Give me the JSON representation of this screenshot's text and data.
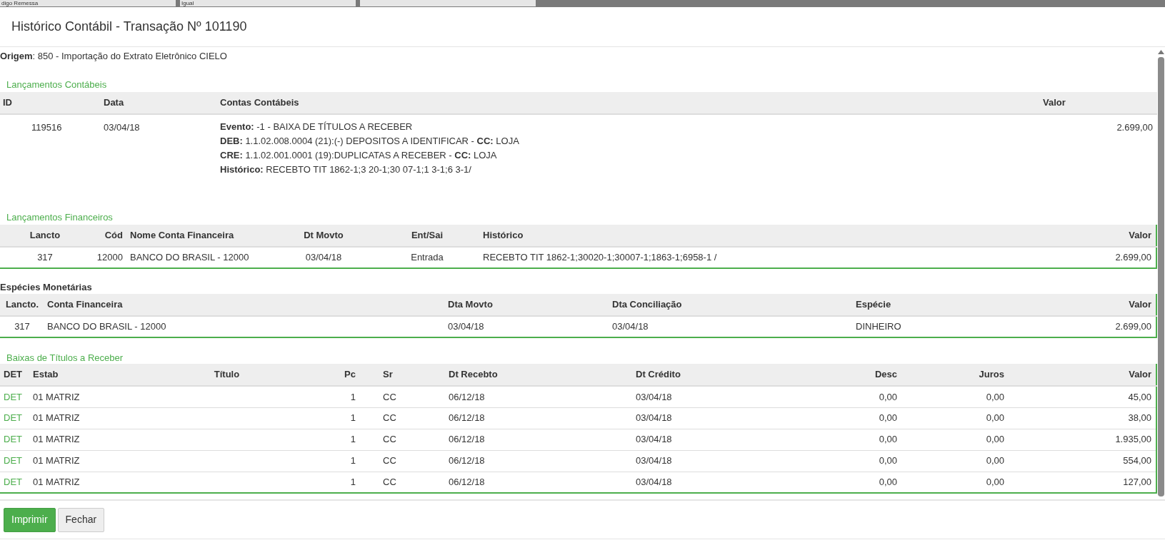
{
  "background_page": {
    "fields": [
      "digo Remessa",
      "Igual"
    ]
  },
  "dialog": {
    "title": "Histórico Contábil - Transação Nº 101190"
  },
  "origin": "**Origem**: 850 - Importação do Extrato Eletrônico CIELO",
  "accounting_entries": {
    "title": "Lançamentos Contábeis",
    "columns": [
      "ID",
      "Data",
      "Contas Contábeis",
      "Valor"
    ],
    "rows": [
      {
        "id": "119516",
        "date": "03/04/18",
        "lines": [
          "**Evento:** -1 - BAIXA DE TÍTULOS A RECEBER",
          "**DEB:** 1.1.02.008.0004 (21):(-) DEPOSITOS A IDENTIFICAR - **CC:** LOJA",
          "**CRE:** 1.1.02.001.0001 (19):DUPLICATAS A RECEBER - **CC:** LOJA",
          "**Histórico:** RECEBTO TIT 1862-1;3  20-1;30  07-1;1  3-1;6  3-1/"
        ],
        "value": "2.699,00"
      }
    ]
  },
  "financial_entries": {
    "title": "Lançamentos Financeiros",
    "columns": [
      "Lancto",
      "Cód",
      "Nome Conta Financeira",
      "Dt Movto",
      "Ent/Sai",
      "Histórico",
      "Valor"
    ],
    "rows": [
      [
        "317",
        "12000",
        "BANCO DO BRASIL - 12000",
        "03/04/18",
        "Entrada",
        "RECEBTO TIT 1862-1;30020-1;30007-1;1863-1;6958-1 /",
        "2.699,00"
      ]
    ]
  },
  "cash_species": {
    "title": "Espécies Monetárias",
    "columns": [
      "Lancto.",
      "Conta Financeira",
      "Dta Movto",
      "Dta Conciliação",
      "Espécie",
      "Valor"
    ],
    "rows": [
      [
        "317",
        "BANCO DO BRASIL - 12000",
        "03/04/18",
        "03/04/18",
        "DINHEIRO",
        "2.699,00"
      ]
    ]
  },
  "receivables": {
    "title": "Baixas de Títulos a Receber",
    "columns": [
      "DET",
      "Estab",
      "Título",
      "Pc",
      "Sr",
      "Dt Recebto",
      "Dt Crédito",
      "Desc",
      "Juros",
      "Valor"
    ],
    "rows": [
      {
        "det": "DET",
        "estab": "01 MATRIZ",
        "pc": "1",
        "sr": "CC",
        "received": "06/12/18",
        "credited": "03/04/18",
        "discount": "0,00",
        "interest": "0,00",
        "value": "45,00"
      },
      {
        "det": "DET",
        "estab": "01 MATRIZ",
        "pc": "1",
        "sr": "CC",
        "received": "06/12/18",
        "credited": "03/04/18",
        "discount": "0,00",
        "interest": "0,00",
        "value": "38,00"
      },
      {
        "det": "DET",
        "estab": "01 MATRIZ",
        "pc": "1",
        "sr": "CC",
        "received": "06/12/18",
        "credited": "03/04/18",
        "discount": "0,00",
        "interest": "0,00",
        "value": "1.935,00"
      },
      {
        "det": "DET",
        "estab": "01 MATRIZ",
        "pc": "1",
        "sr": "CC",
        "received": "06/12/18",
        "credited": "03/04/18",
        "discount": "0,00",
        "interest": "0,00",
        "value": "554,00"
      },
      {
        "det": "DET",
        "estab": "01 MATRIZ",
        "pc": "1",
        "sr": "CC",
        "received": "06/12/18",
        "credited": "03/04/18",
        "discount": "0,00",
        "interest": "0,00",
        "value": "127,00"
      }
    ]
  },
  "buttons": [
    {
      "label": "Imprimir",
      "kind": "primary"
    },
    {
      "label": "Fechar",
      "kind": "default"
    }
  ]
}
